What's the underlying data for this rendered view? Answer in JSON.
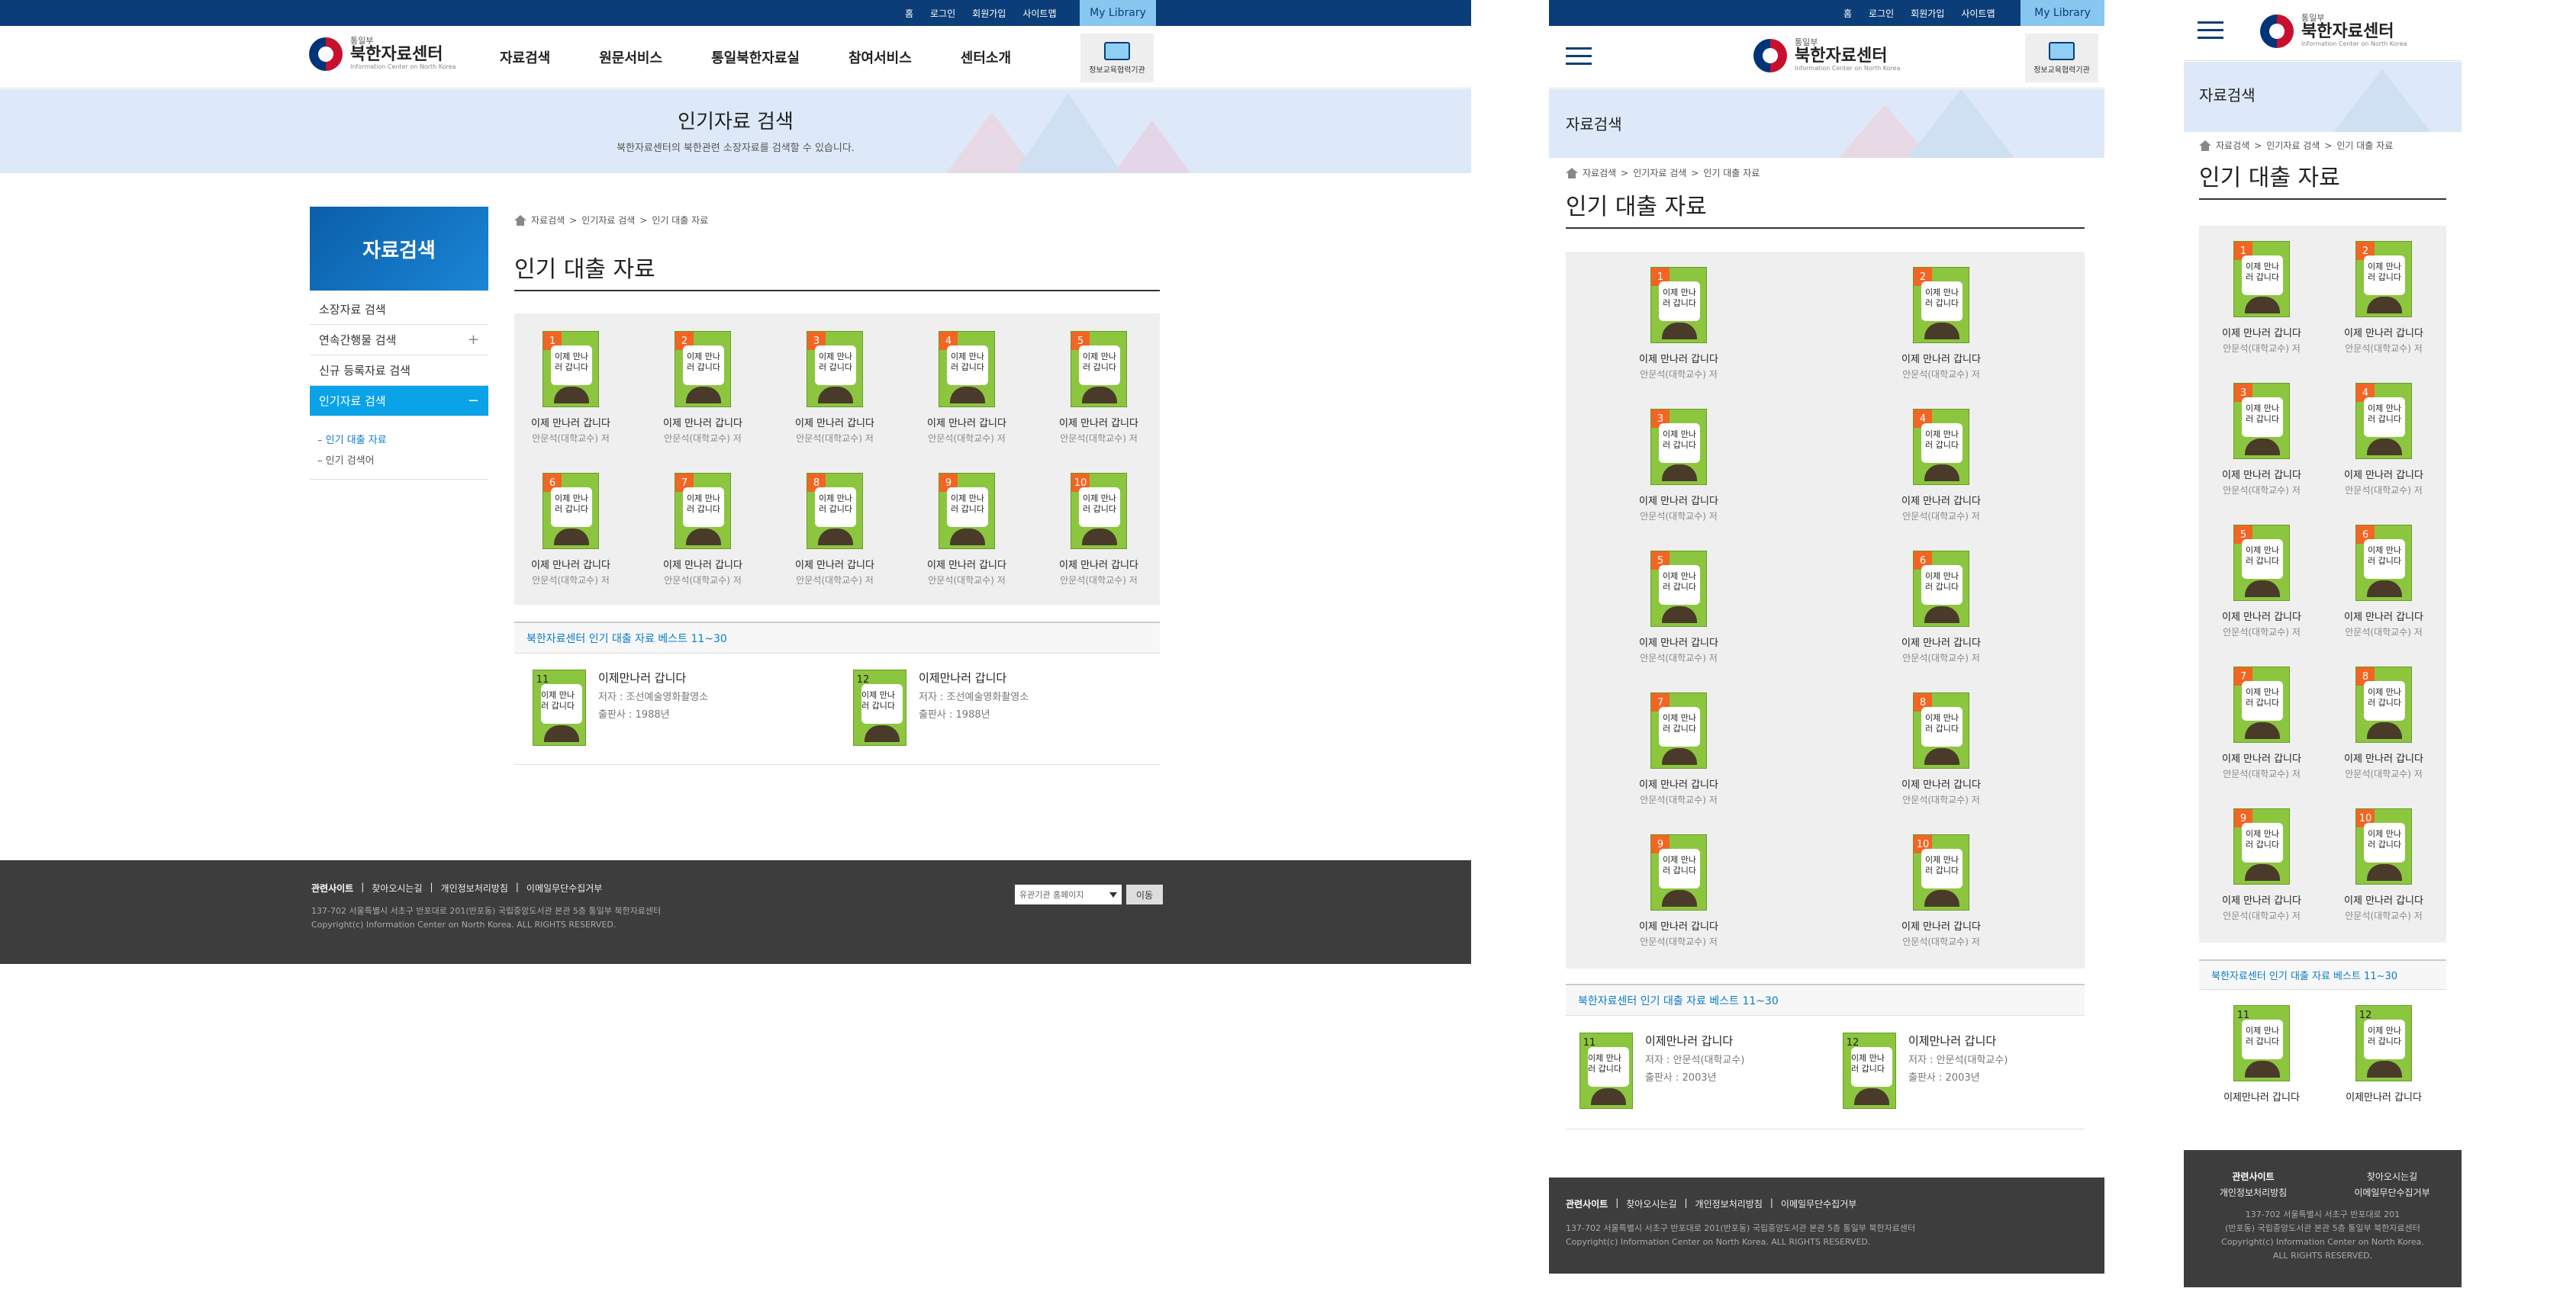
{
  "site": {
    "logo_sup": "통일부",
    "logo_main": "북한자료센터",
    "logo_en": "Information Center on North Korea",
    "util": [
      "홈",
      "로그인",
      "회원가입",
      "사이트맵"
    ],
    "mylib": "My Library",
    "notebook": "정보교육협력기관",
    "gnb": [
      "자료검색",
      "원문서비스",
      "통일북한자료실",
      "참여서비스",
      "센터소개"
    ]
  },
  "banner": {
    "title": "인기자료 검색",
    "desc": "북한자료센터의 북한관련 소장자료를 검색할 수 있습니다.",
    "mobile_title": "자료검색"
  },
  "lnb": {
    "title": "자료검색",
    "items": [
      "소장자료 검색",
      "연속간행물 검색",
      "신규 등록자료 검색",
      "인기자료 검색"
    ],
    "sub": [
      "인기 대출 자료",
      "인기 검색어"
    ]
  },
  "breadcrumb": [
    "자료검색",
    "인기자료 검색",
    "인기 대출 자료"
  ],
  "page_title": "인기 대출 자료",
  "books": [
    {
      "num": "1",
      "title": "이제 만나러 갑니다",
      "author": "안문석(대학교수) 저"
    },
    {
      "num": "2",
      "title": "이제 만나러 갑니다",
      "author": "안문석(대학교수) 저"
    },
    {
      "num": "3",
      "title": "이제 만나러 갑니다",
      "author": "안문석(대학교수) 저"
    },
    {
      "num": "4",
      "title": "이제 만나러 갑니다",
      "author": "안문석(대학교수) 저"
    },
    {
      "num": "5",
      "title": "이제 만나러 갑니다",
      "author": "안문석(대학교수) 저"
    },
    {
      "num": "6",
      "title": "이제 만나러 갑니다",
      "author": "안문석(대학교수) 저"
    },
    {
      "num": "7",
      "title": "이제 만나러 갑니다",
      "author": "안문석(대학교수) 저"
    },
    {
      "num": "8",
      "title": "이제 만나러 갑니다",
      "author": "안문석(대학교수) 저"
    },
    {
      "num": "9",
      "title": "이제 만나러 갑니다",
      "author": "안문석(대학교수) 저"
    },
    {
      "num": "10",
      "title": "이제 만나러 갑니다",
      "author": "안문석(대학교수) 저"
    }
  ],
  "cover_text": "이제 만나러 갑니다",
  "best": {
    "heading": "북한자료센터 인기 대출 자료 베스트 11~30",
    "desktop": [
      {
        "num": "11",
        "title": "이제만나러 갑니다",
        "author": "저자 : 조선예술영화촬영소",
        "pub": "출판사 : 1988년"
      },
      {
        "num": "12",
        "title": "이제만나러 갑니다",
        "author": "저자 : 조선예술영화촬영소",
        "pub": "출판사 : 1988년"
      }
    ],
    "tablet": [
      {
        "num": "11",
        "title": "이제만나러 갑니다",
        "author": "저자 : 안문석(대학교수)",
        "pub": "출판사 : 2003년"
      },
      {
        "num": "12",
        "title": "이제만나러 갑니다",
        "author": "저자 : 안문석(대학교수)",
        "pub": "출판사 : 2003년"
      }
    ]
  },
  "footer": {
    "links": [
      "관련사이트",
      "찾아오시는길",
      "개인정보처리방침",
      "이메일무단수집거부"
    ],
    "addr1": "137-702 서울특별시 서초구 반포대로 201(반포동) 국립중앙도서관 본관 5층 통일부 북한자료센터",
    "addr2": "Copyright(c) Information Center on North Korea. ALL RIGHTS RESERVED.",
    "select": "유관기관 홈페이지",
    "go": "이동",
    "m_addr1": "137-702 서울특별시 서초구 반포대로 201",
    "m_addr2": "(반포동) 국립중앙도서관 본관 5층 통일부 북한자료센터",
    "m_copy1": "Copyright(c) Information Center on North Korea.",
    "m_copy2": "ALL RIGHTS RESERVED."
  }
}
